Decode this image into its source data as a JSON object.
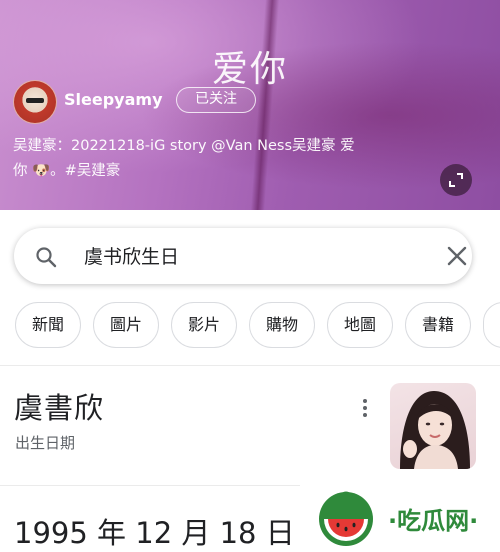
{
  "banner": {
    "title": "爱你",
    "username": "Sleepyamy",
    "follow_label": "已关注",
    "caption_line1": "吴建豪：20221218-iG story @Van Ness吴建豪 爱",
    "caption_line2": "你 🐶。#吴建豪",
    "expand_icon": "expand-icon"
  },
  "search": {
    "query": "虞书欣生日",
    "search_icon": "search-icon",
    "clear_icon": "close-icon"
  },
  "chips": [
    "新聞",
    "圖片",
    "影片",
    "購物",
    "地圖",
    "書籍"
  ],
  "result": {
    "name": "虞書欣",
    "subtitle": "出生日期",
    "answer": "1995 年 12 月 18 日"
  },
  "watermark": {
    "text": "·吃瓜网·"
  },
  "colors": {
    "banner_purple": "#a766b8",
    "watermark_green": "#2f8a3b"
  }
}
